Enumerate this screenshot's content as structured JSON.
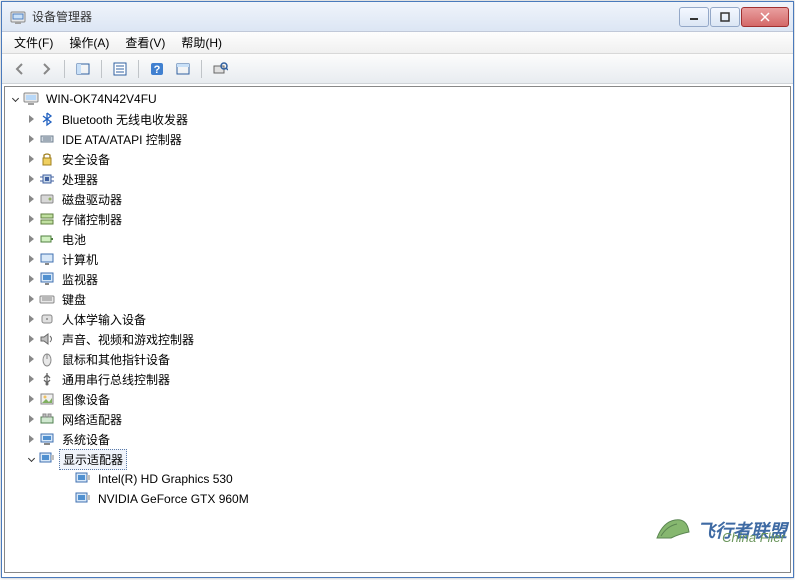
{
  "window": {
    "title": "设备管理器"
  },
  "menubar": {
    "file": "文件(F)",
    "action": "操作(A)",
    "view": "查看(V)",
    "help": "帮助(H)"
  },
  "tree": {
    "root": "WIN-OK74N42V4FU",
    "categories": [
      {
        "label": "Bluetooth 无线电收发器",
        "icon": "bluetooth-icon"
      },
      {
        "label": "IDE ATA/ATAPI 控制器",
        "icon": "ide-icon"
      },
      {
        "label": "安全设备",
        "icon": "security-icon"
      },
      {
        "label": "处理器",
        "icon": "processor-icon"
      },
      {
        "label": "磁盘驱动器",
        "icon": "disk-icon"
      },
      {
        "label": "存储控制器",
        "icon": "storage-icon"
      },
      {
        "label": "电池",
        "icon": "battery-icon"
      },
      {
        "label": "计算机",
        "icon": "computer-icon"
      },
      {
        "label": "监视器",
        "icon": "monitor-icon"
      },
      {
        "label": "键盘",
        "icon": "keyboard-icon"
      },
      {
        "label": "人体学输入设备",
        "icon": "hid-icon"
      },
      {
        "label": "声音、视频和游戏控制器",
        "icon": "sound-icon"
      },
      {
        "label": "鼠标和其他指针设备",
        "icon": "mouse-icon"
      },
      {
        "label": "通用串行总线控制器",
        "icon": "usb-icon"
      },
      {
        "label": "图像设备",
        "icon": "image-icon"
      },
      {
        "label": "网络适配器",
        "icon": "network-icon"
      },
      {
        "label": "系统设备",
        "icon": "system-icon"
      }
    ],
    "displayAdapters": {
      "label": "显示适配器",
      "items": [
        "Intel(R) HD Graphics 530",
        "NVIDIA GeForce GTX 960M"
      ]
    }
  },
  "watermark": {
    "line1": "飞行者联盟",
    "line2": "China Flier"
  }
}
